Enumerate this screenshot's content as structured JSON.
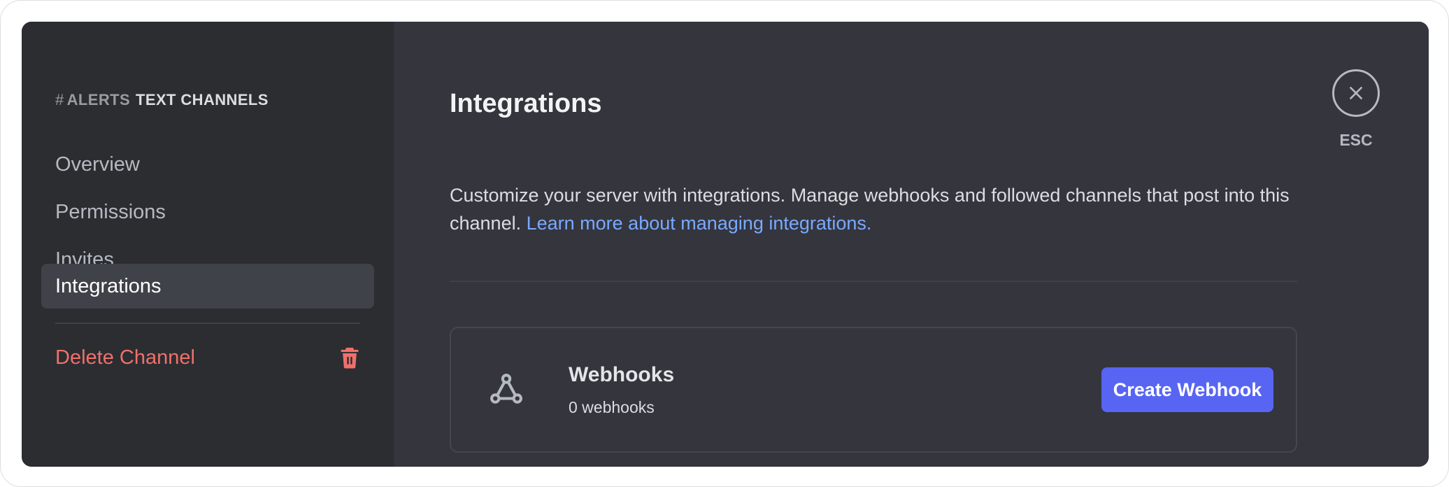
{
  "sidebar": {
    "header": {
      "hash": "#",
      "channel": "alerts",
      "category": "Text Channels"
    },
    "items": [
      {
        "label": "Overview",
        "active": false
      },
      {
        "label": "Permissions",
        "active": false
      },
      {
        "label": "Invites",
        "active": false
      },
      {
        "label": "Integrations",
        "active": true
      }
    ],
    "delete_label": "Delete Channel",
    "delete_icon": "trash-icon"
  },
  "main": {
    "title": "Integrations",
    "description": "Customize your server with integrations. Manage webhooks and followed channels that post into this channel.",
    "learn_more_link": "Learn more about managing integrations.",
    "webhooks_card": {
      "icon": "webhook-icon",
      "title": "Webhooks",
      "subtitle": "0 webhooks",
      "button_label": "Create Webhook"
    }
  },
  "close": {
    "icon": "close-icon",
    "label": "ESC"
  },
  "colors": {
    "accent": "#5865f2",
    "danger": "#f0706b",
    "link": "#7aa9ff",
    "sidebar_bg": "#2b2d31",
    "content_bg": "#34353d"
  }
}
